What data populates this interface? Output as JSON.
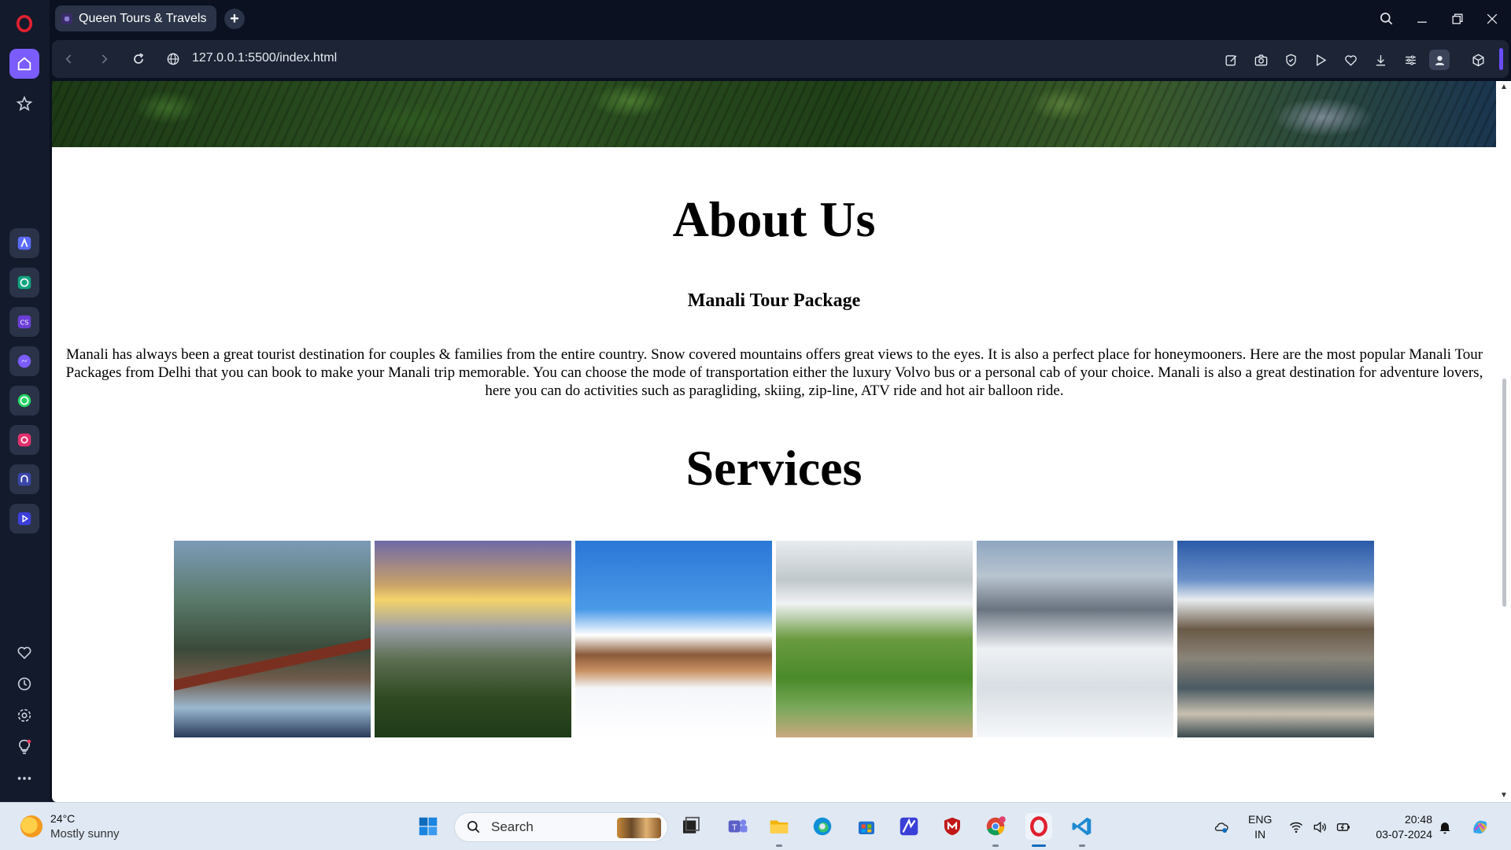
{
  "browser": {
    "tab_title": "Queen Tours & Travels",
    "new_tab_symbol": "+",
    "url": "127.0.0.1:5500/index.html"
  },
  "page": {
    "about_heading": "About Us",
    "package_heading": "Manali Tour Package",
    "about_paragraph": "Manali has always been a great tourist destination for couples & families from the entire country. Snow covered mountains offers great views to the eyes. It is also a perfect place for honeymooners. Here are the most popular Manali Tour Packages from Delhi that you can book to make your Manali trip memorable. You can choose the mode of transportation either the luxury Volvo bus or a personal cab of your choice. Manali is also a great destination for adventure lovers, here you can do activities such as paragliding, skiing, zip-line, ATV ride and hot air balloon ride.",
    "services_heading": "Services",
    "gallery_count": 6
  },
  "taskbar": {
    "weather_temp": "24°C",
    "weather_desc": "Mostly sunny",
    "search_placeholder": "Search",
    "lang_line1": "ENG",
    "lang_line2": "IN",
    "time": "20:48",
    "date": "03-07-2024"
  },
  "colors": {
    "browser_bg": "#0b1120",
    "addressbar_bg": "#1c2436",
    "rail_bg": "#121a2b",
    "opera_red": "#e0202f",
    "taskbar_bg": "#dfe8f3",
    "accent_blue": "#0f6cbd"
  },
  "icons": {
    "rail": [
      "opera-logo-icon",
      "home-icon",
      "star-icon",
      "aria-icon",
      "chatgpt-icon",
      "chatsonic-icon",
      "messenger-icon",
      "whatsapp-icon",
      "instagram-icon",
      "music-player-icon",
      "player-icon",
      "heart-icon",
      "history-icon",
      "settings-icon",
      "tips-icon",
      "more-icon"
    ],
    "toolbar": [
      "snapshot-edit-icon",
      "camera-icon",
      "shield-icon",
      "send-icon",
      "heart-icon",
      "download-icon",
      "easy-setup-icon",
      "profile-icon",
      "extensions-cube-icon"
    ]
  }
}
